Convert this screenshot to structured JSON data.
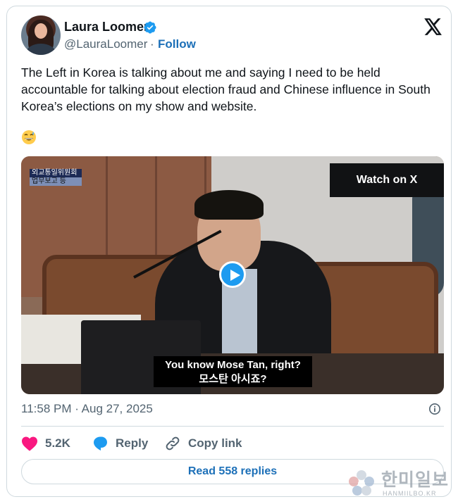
{
  "author": {
    "name": "Laura Loomer",
    "handle": "@LauraLoomer",
    "separator": "·",
    "follow_label": "Follow"
  },
  "tweet": {
    "text": "The Left in Korea is talking about me and saying I need to be held accountable for talking about election fraud and Chinese influence in South Korea’s elections on my show and website.",
    "emoji": "😅"
  },
  "media": {
    "watch_label": "Watch on X",
    "tag_line1": "외교통일위원회",
    "tag_line2": "업무보고 등",
    "subtitle_en": "You know Mose Tan, right?",
    "subtitle_ko": "모스탄 아시죠?"
  },
  "timestamp": "11:58 PM · Aug 27, 2025",
  "actions": {
    "like_count": "5.2K",
    "reply_label": "Reply",
    "copy_label": "Copy link"
  },
  "read_replies_label": "Read 558 replies",
  "watermark": {
    "korean": "한미일보",
    "english": "HANMIILBO.KR"
  },
  "colors": {
    "link": "#1d70b8",
    "like": "#f91880",
    "verified": "#1d9bf0",
    "muted": "#536471"
  }
}
